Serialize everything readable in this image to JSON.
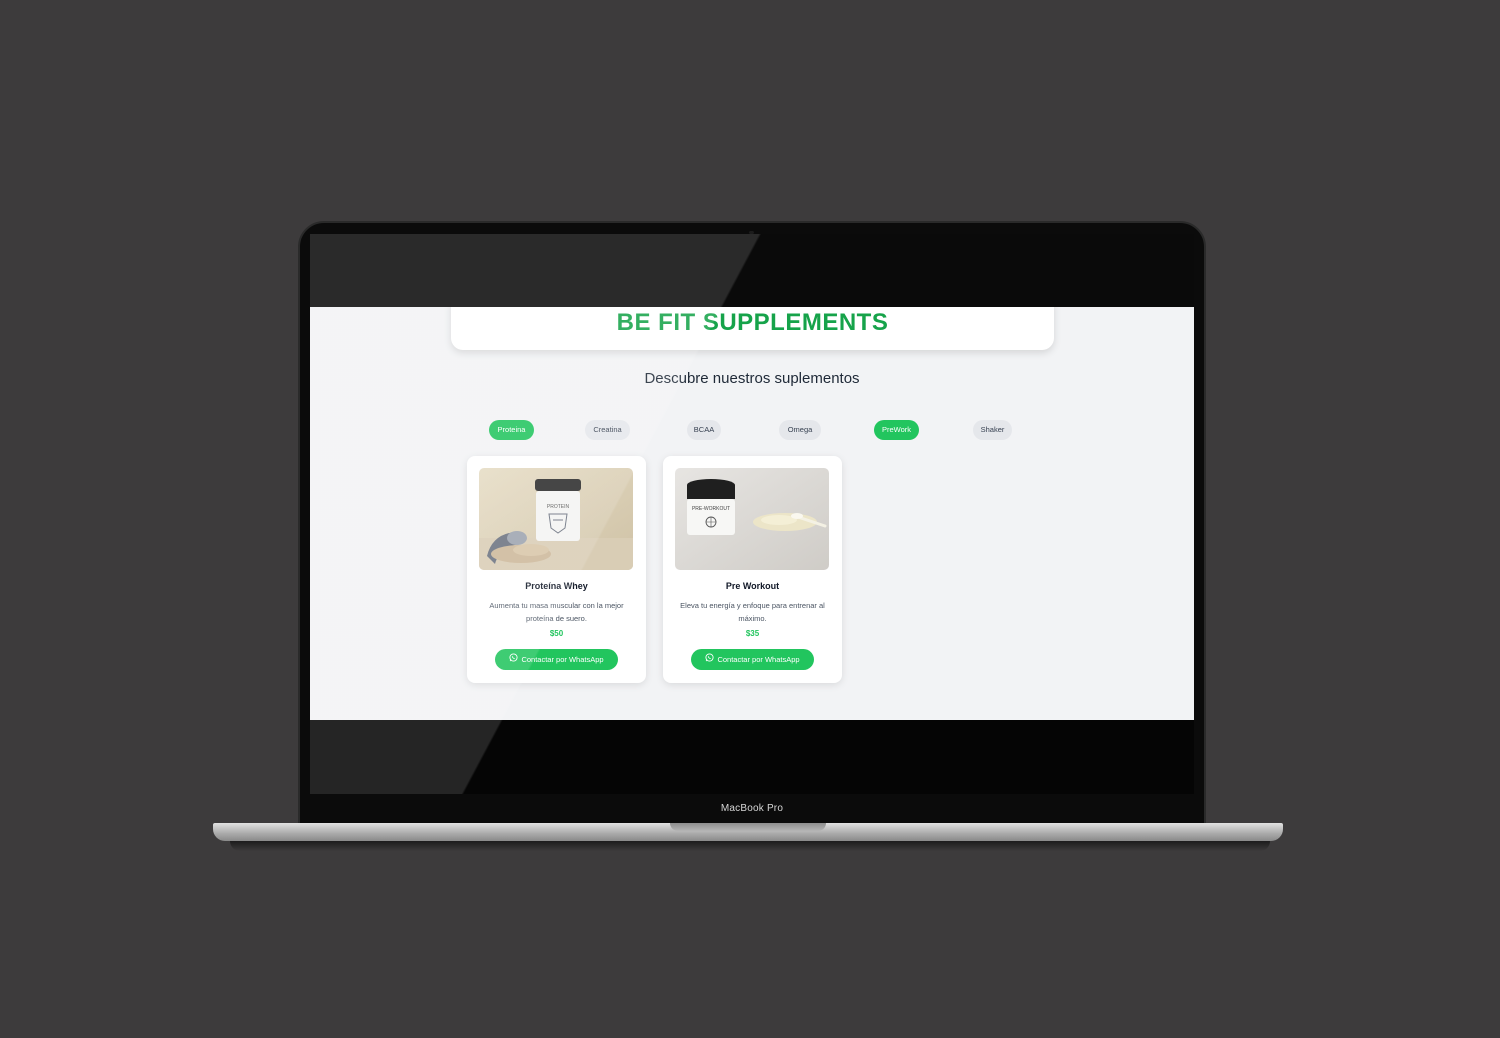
{
  "device": {
    "model_label": "MacBook Pro"
  },
  "header": {
    "brand": "BE FIT SUPPLEMENTS"
  },
  "hero": {
    "subtitle": "Descubre nuestros suplementos"
  },
  "categories": [
    {
      "label": "Proteina",
      "active": true
    },
    {
      "label": "Creatina",
      "active": false
    },
    {
      "label": "BCAA",
      "active": false
    },
    {
      "label": "Omega",
      "active": false
    },
    {
      "label": "PreWork",
      "active": true
    },
    {
      "label": "Shaker",
      "active": false
    }
  ],
  "products": [
    {
      "name": "Proteína Whey",
      "description": "Aumenta tu masa muscular con la mejor proteína de suero.",
      "price": "$50",
      "cta": "Contactar por WhatsApp",
      "image_icon": "protein-jar-image"
    },
    {
      "name": "Pre Workout",
      "description": "Eleva tu energía y enfoque para entrenar al máximo.",
      "price": "$35",
      "cta": "Contactar por WhatsApp",
      "image_icon": "preworkout-jar-image"
    }
  ],
  "colors": {
    "brand_green": "#16a34a",
    "accent_green": "#22c55e",
    "page_bg": "#f2f3f5",
    "backdrop": "#3d3b3c"
  }
}
